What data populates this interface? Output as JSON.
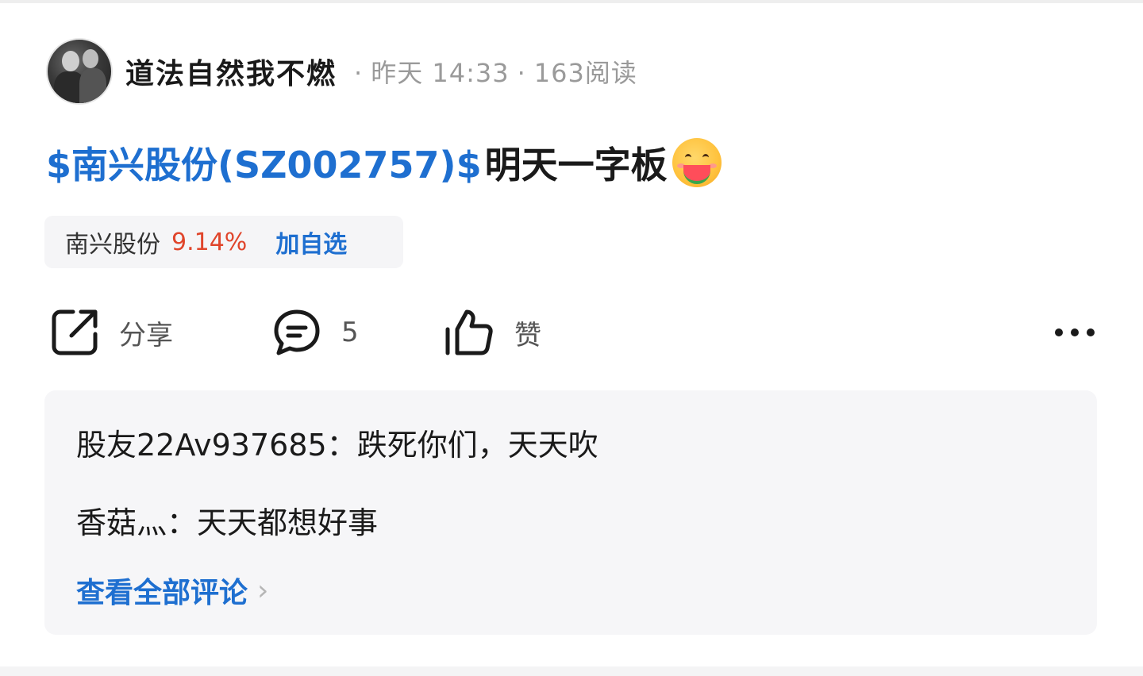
{
  "header": {
    "username": "道法自然我不燃",
    "time": "昨天 14:33",
    "separator": "·",
    "reads": "163阅读"
  },
  "post": {
    "stock_tag": "$南兴股份(SZ002757)$",
    "text": "明天一字板",
    "emoji_name": "face-eating-watermelon-emoji"
  },
  "stock_chip": {
    "name": "南兴股份",
    "change": "9.14%",
    "add_label": "加自选"
  },
  "actions": {
    "share_label": "分享",
    "comment_count": "5",
    "like_label": "赞",
    "more_icon": "more-icon"
  },
  "comments": {
    "items": [
      {
        "author": "股友22Av937685",
        "colon": "：",
        "text": "跌死你们，天天吹"
      },
      {
        "author": "香菇灬",
        "colon": "：",
        "text": "天天都想好事"
      }
    ],
    "view_all_label": "查看全部评论",
    "chevron": "›"
  },
  "colors": {
    "link_blue": "#1e6fd0",
    "up_red": "#e0452b",
    "muted_gray": "#9a9a9a"
  }
}
